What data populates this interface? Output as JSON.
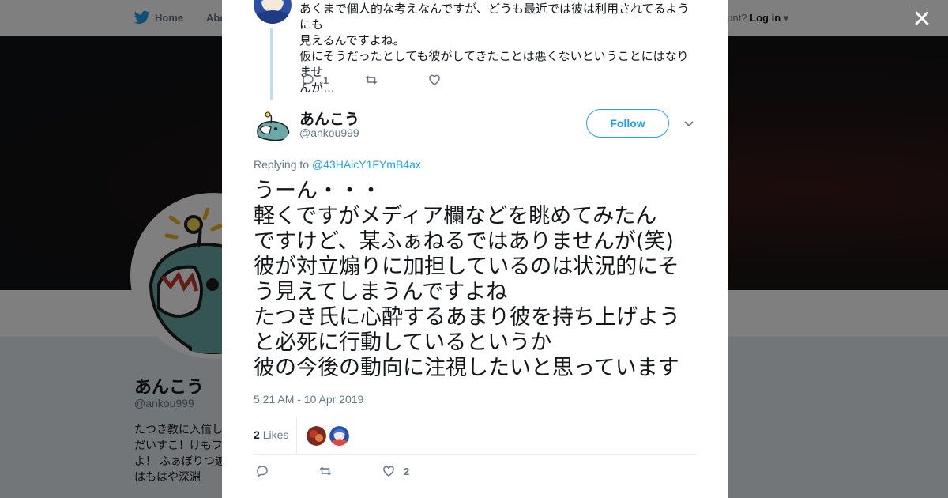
{
  "topnav": {
    "home_label": "Home",
    "about_label": "Abo",
    "account_prompt": "ccount?",
    "login_label": "Log in"
  },
  "background_profile": {
    "name": "あんこう",
    "handle": "@ankou999",
    "bio_lines": [
      "たつき教に入信し",
      "だいすこ！けもフ",
      "よ！ ふぁぼりつ遊",
      "はもはや深淵"
    ]
  },
  "modal": {
    "previous_tweet": {
      "text_lines": [
        "あくまで個人的な考えなんですが、どうも最近では彼は利用されてるようにも",
        "見えるんですよね。",
        "仮にそうだったとしても彼がしてきたことは悪くないということにはなりませ",
        "んが…"
      ],
      "reply_count": "1"
    },
    "author": {
      "name": "あんこう",
      "handle": "@ankou999",
      "follow_label": "Follow"
    },
    "replying_prefix": "Replying to",
    "replying_handle": "@43HAicY1FYmB4ax",
    "tweet_text": "うーん・・・\n軽くですがメディア欄などを眺めてみたん\nですけど、某ふぁねるではありませんが(笑)\n彼が対立煽りに加担しているのは状況的にそ\nう見えてしまうんですよね\nたつき氏に心酔するあまり彼を持ち上げよう\nと必死に行動しているというか\n彼の今後の動向に注視したいと思っています",
    "timestamp": "5:21 AM - 10 Apr 2019",
    "likes_count": "2",
    "likes_label": "Likes",
    "action_like_count": "2"
  },
  "colors": {
    "accent": "#1da1f2",
    "muted": "#657786",
    "thread_line": "#b7dff8"
  }
}
